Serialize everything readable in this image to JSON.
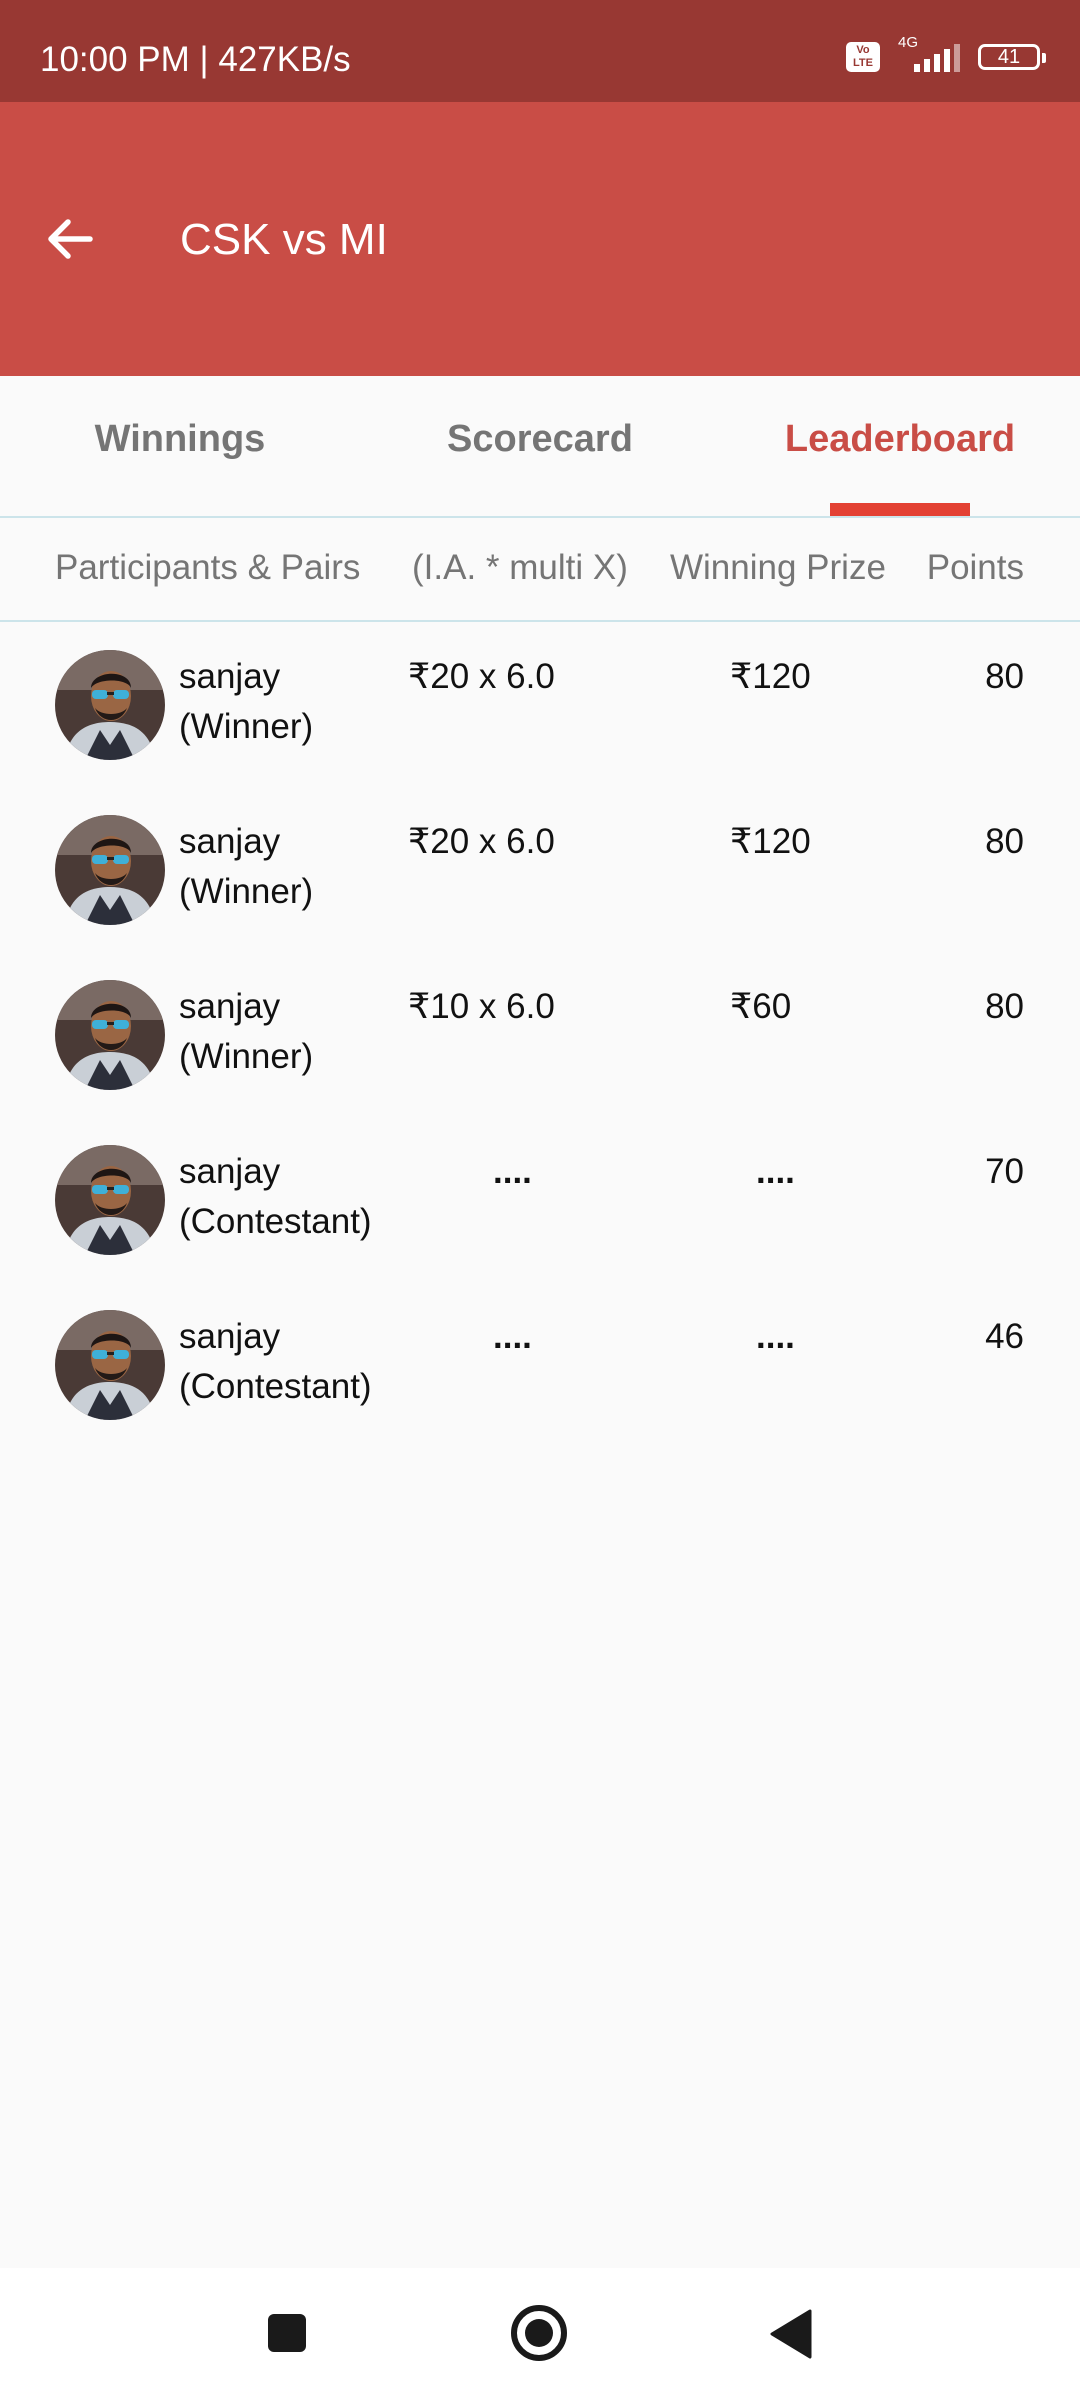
{
  "status_bar": {
    "time": "10:00 PM | 427KB/s",
    "volte": "Vo LTE",
    "network": "4G",
    "battery": "41"
  },
  "app_bar": {
    "title": "CSK vs MI"
  },
  "tabs": [
    {
      "label": "Winnings",
      "active": false
    },
    {
      "label": "Scorecard",
      "active": false
    },
    {
      "label": "Leaderboard",
      "active": true
    }
  ],
  "columns": {
    "participants": "Participants & Pairs",
    "ia_multi": "(I.A. * multi X)",
    "winning_prize": "Winning Prize",
    "points": "Points"
  },
  "rows": [
    {
      "name": "sanjay",
      "role": "(Winner)",
      "ia": "₹20 x 6.0",
      "prize": "₹120",
      "points": "80"
    },
    {
      "name": "sanjay",
      "role": "(Winner)",
      "ia": "₹20 x 6.0",
      "prize": "₹120",
      "points": "80"
    },
    {
      "name": "sanjay",
      "role": "(Winner)",
      "ia": "₹10 x 6.0",
      "prize": "₹60",
      "points": "80"
    },
    {
      "name": "sanjay",
      "role": "(Contestant)",
      "ia": "....",
      "prize": "....",
      "points": "70"
    },
    {
      "name": "sanjay",
      "role": "(Contestant)",
      "ia": "....",
      "prize": "....",
      "points": "46"
    }
  ],
  "nav_bar": {
    "icons": [
      "recents-square-icon",
      "home-circle-icon",
      "back-triangle-icon"
    ]
  },
  "colors": {
    "status_bar": "#983833",
    "app_bar": "#c94d46",
    "tab_active": "#c94d46",
    "indicator": "#e34133"
  }
}
